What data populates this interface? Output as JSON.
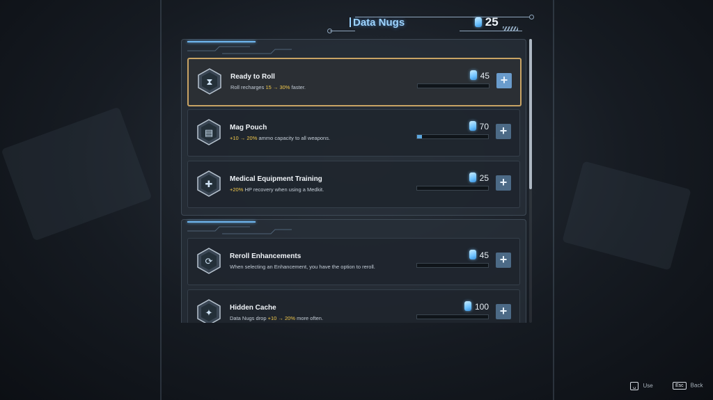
{
  "header": {
    "title": "Data Nugs",
    "currency_amount": "25",
    "currency_icon": "data-nug-icon"
  },
  "sections": [
    {
      "cards": [
        {
          "title": "Ready to Roll",
          "desc_pre": "Roll recharges ",
          "desc_hl": "15 → 30%",
          "desc_post": " faster.",
          "cost": "45",
          "progress": 0,
          "selected": true,
          "icon": "hourglass-icon"
        },
        {
          "title": "Mag Pouch",
          "desc_pre": "",
          "desc_hl": "+10 → 20%",
          "desc_post": " ammo capacity to all weapons.",
          "cost": "70",
          "progress": 0.07,
          "selected": false,
          "icon": "ammo-pouch-icon"
        },
        {
          "title": "Medical Equipment Training",
          "desc_pre": "",
          "desc_hl": "+20%",
          "desc_post": " HP recovery when using a Medkit.",
          "cost": "25",
          "progress": 0,
          "selected": false,
          "icon": "medic-icon"
        }
      ]
    },
    {
      "cards": [
        {
          "title": "Reroll Enhancements",
          "desc_pre": "When selecting an Enhancement, you have the option to reroll.",
          "desc_hl": "",
          "desc_post": "",
          "cost": "45",
          "progress": 0,
          "selected": false,
          "icon": "reroll-icon"
        },
        {
          "title": "Hidden Cache",
          "desc_pre": "Data Nugs drop ",
          "desc_hl": "+10 → 20%",
          "desc_post": " more often.",
          "cost": "100",
          "progress": 0,
          "selected": false,
          "icon": "cache-icon"
        }
      ]
    }
  ],
  "footer": {
    "use_key": "␣",
    "use_label": "Use",
    "back_key": "Esc",
    "back_label": "Back"
  },
  "colors": {
    "accent_blue": "#9dd4ff",
    "highlight_yellow": "#f2c94c",
    "selected_border": "#c9a464"
  }
}
